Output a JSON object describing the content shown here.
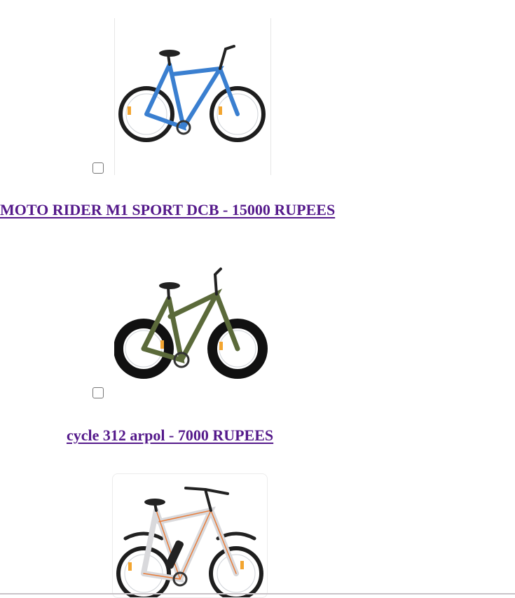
{
  "products": [
    {
      "title": "MOTO RIDER M1 SPORT DCB - 15000 RUPEES",
      "image_icon": "blue-bicycle",
      "frame_color": "#3a7fd0",
      "selected": false
    },
    {
      "title": "cycle 312 arpol - 7000 RUPEES",
      "image_icon": "green-camo-fat-tyre-bicycle",
      "frame_color": "#5b6a3a",
      "selected": false
    },
    {
      "title": "",
      "image_icon": "silver-electric-bicycle",
      "frame_color": "#d9d9dc",
      "selected": false
    }
  ],
  "colors": {
    "link": "#551a8b",
    "checkbox_border": "#767676"
  }
}
